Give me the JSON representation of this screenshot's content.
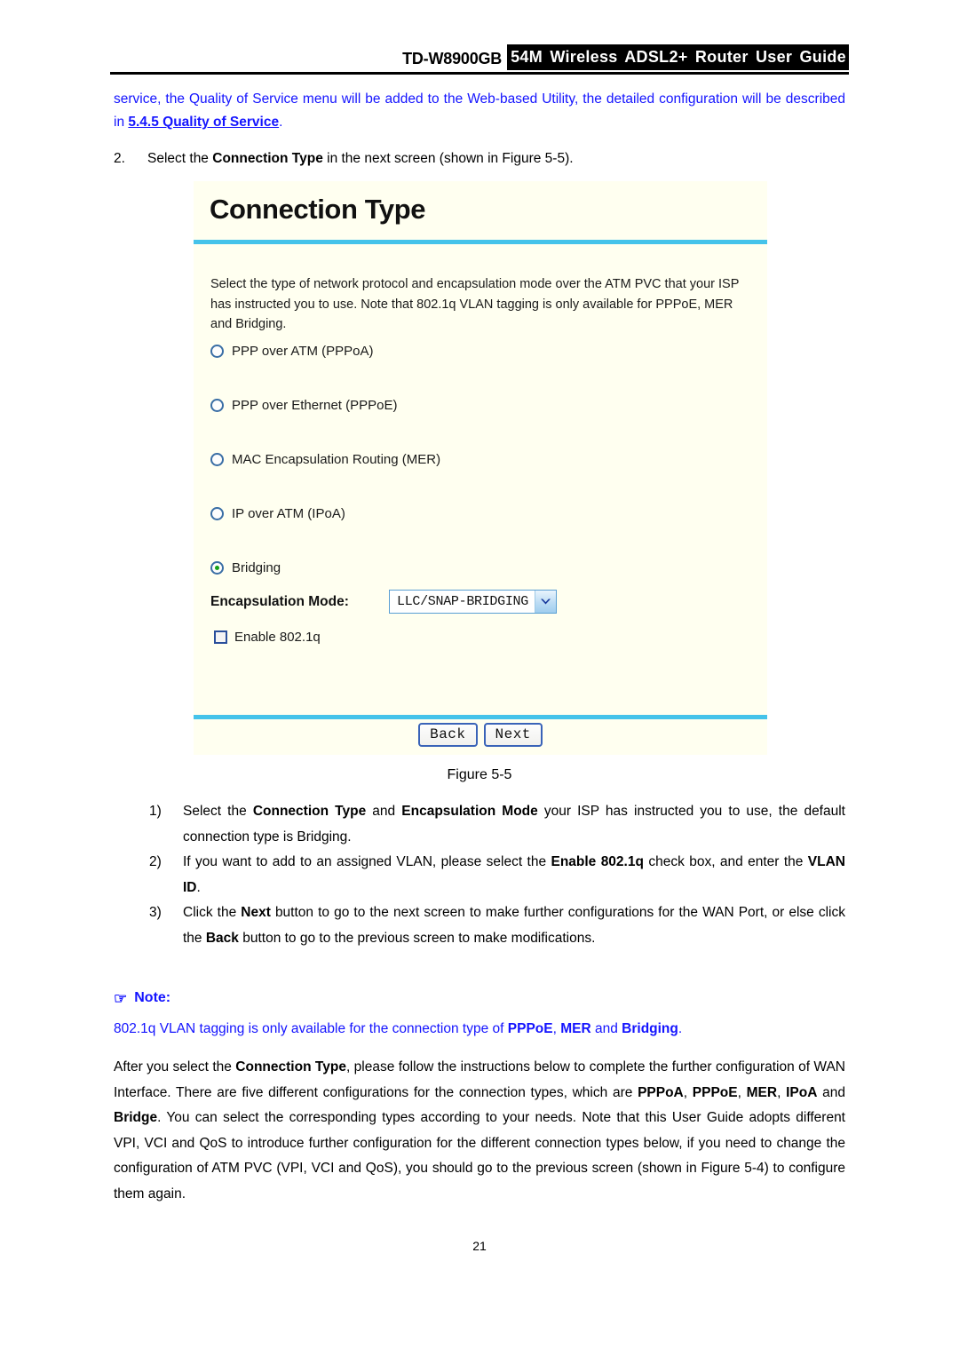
{
  "header": {
    "model": "TD-W8900GB",
    "band_title": "54M Wireless ADSL2+ Router User Guide"
  },
  "intro_paragraph": {
    "text_before": "service, the Quality of Service menu will be added to the Web-based Utility, the detailed configuration will be described in ",
    "link": "5.4.5 Quality of Service",
    "text_after": "."
  },
  "step_two": {
    "number": "2.",
    "text_before": "Select the ",
    "bold1": "Connection Type",
    "text_after": " in the next screen (shown in Figure 5-5)."
  },
  "router_panel": {
    "title": "Connection Type",
    "description": "Select the type of network protocol and encapsulation mode over the ATM PVC that your ISP has instructed you to use. Note that 802.1q VLAN tagging is only available for PPPoE, MER and Bridging.",
    "options": [
      {
        "label": "PPP over ATM (PPPoA)",
        "selected": false
      },
      {
        "label": "PPP over Ethernet (PPPoE)",
        "selected": false
      },
      {
        "label": "MAC Encapsulation Routing (MER)",
        "selected": false
      },
      {
        "label": "IP over ATM (IPoA)",
        "selected": false
      },
      {
        "label": "Bridging",
        "selected": true
      }
    ],
    "encapsulation": {
      "label": "Encapsulation Mode:",
      "value": "LLC/SNAP-BRIDGING"
    },
    "enable_8021q": {
      "label": "Enable 802.1q",
      "checked": false
    },
    "buttons": {
      "back": "Back",
      "next": "Next"
    },
    "colors": {
      "panel_background": "#fffff0",
      "rule": "#45c3ea",
      "radio_border": "#3a6ea5",
      "radio_dot": "#16a016",
      "button_border": "#3a63b8"
    }
  },
  "figure_caption": "Figure 5-5",
  "numbered_list": [
    {
      "marker": "1)",
      "parts": [
        {
          "t": "Select the ",
          "b": false
        },
        {
          "t": "Connection Type",
          "b": true
        },
        {
          "t": " and ",
          "b": false
        },
        {
          "t": "Encapsulation Mode",
          "b": true
        },
        {
          "t": " your ISP has instructed you to use, the default connection type is Bridging.",
          "b": false
        }
      ]
    },
    {
      "marker": "2)",
      "parts": [
        {
          "t": "If you want to add to an assigned VLAN, please select the ",
          "b": false
        },
        {
          "t": "Enable 802.1q",
          "b": true
        },
        {
          "t": " check box, and enter the ",
          "b": false
        },
        {
          "t": "VLAN ID",
          "b": true
        },
        {
          "t": ".",
          "b": false
        }
      ]
    },
    {
      "marker": "3)",
      "parts": [
        {
          "t": "Click the ",
          "b": false
        },
        {
          "t": "Next",
          "b": true
        },
        {
          "t": " button to go to the next screen to make further configurations for the WAN Port, or else click the ",
          "b": false
        },
        {
          "t": "Back",
          "b": true
        },
        {
          "t": " button to go to the previous screen to make modifications.",
          "b": false
        }
      ]
    }
  ],
  "note": {
    "icon": "☞",
    "title": "Note:",
    "parts": [
      {
        "t": "802.1q VLAN tagging is only available for the connection type of ",
        "b": false
      },
      {
        "t": "PPPoE",
        "b": true
      },
      {
        "t": ", ",
        "b": false
      },
      {
        "t": "MER",
        "b": true
      },
      {
        "t": " and ",
        "b": false
      },
      {
        "t": "Bridging",
        "b": true
      },
      {
        "t": ".",
        "b": false
      }
    ],
    "color": "#1414ff"
  },
  "closing_paragraph": {
    "parts": [
      {
        "t": "After you select the ",
        "b": false
      },
      {
        "t": "Connection Type",
        "b": true
      },
      {
        "t": ", please follow the instructions below to complete the further configuration of WAN Interface. There are five different configurations for the connection types, which are ",
        "b": false
      },
      {
        "t": "PPPoA",
        "b": true
      },
      {
        "t": ", ",
        "b": false
      },
      {
        "t": "PPPoE",
        "b": true
      },
      {
        "t": ", ",
        "b": false
      },
      {
        "t": "MER",
        "b": true
      },
      {
        "t": ", ",
        "b": false
      },
      {
        "t": "IPoA",
        "b": true
      },
      {
        "t": " and ",
        "b": false
      },
      {
        "t": "Bridge",
        "b": true
      },
      {
        "t": ". You can select the corresponding types according to your needs. Note that this User Guide adopts different VPI, VCI and QoS to introduce further configuration for the different connection types below, if you need to change the configuration of ATM PVC (VPI, VCI and QoS), you should go to the previous screen (shown in Figure 5-4) to configure them again.",
        "b": false
      }
    ]
  },
  "page_number": "21"
}
